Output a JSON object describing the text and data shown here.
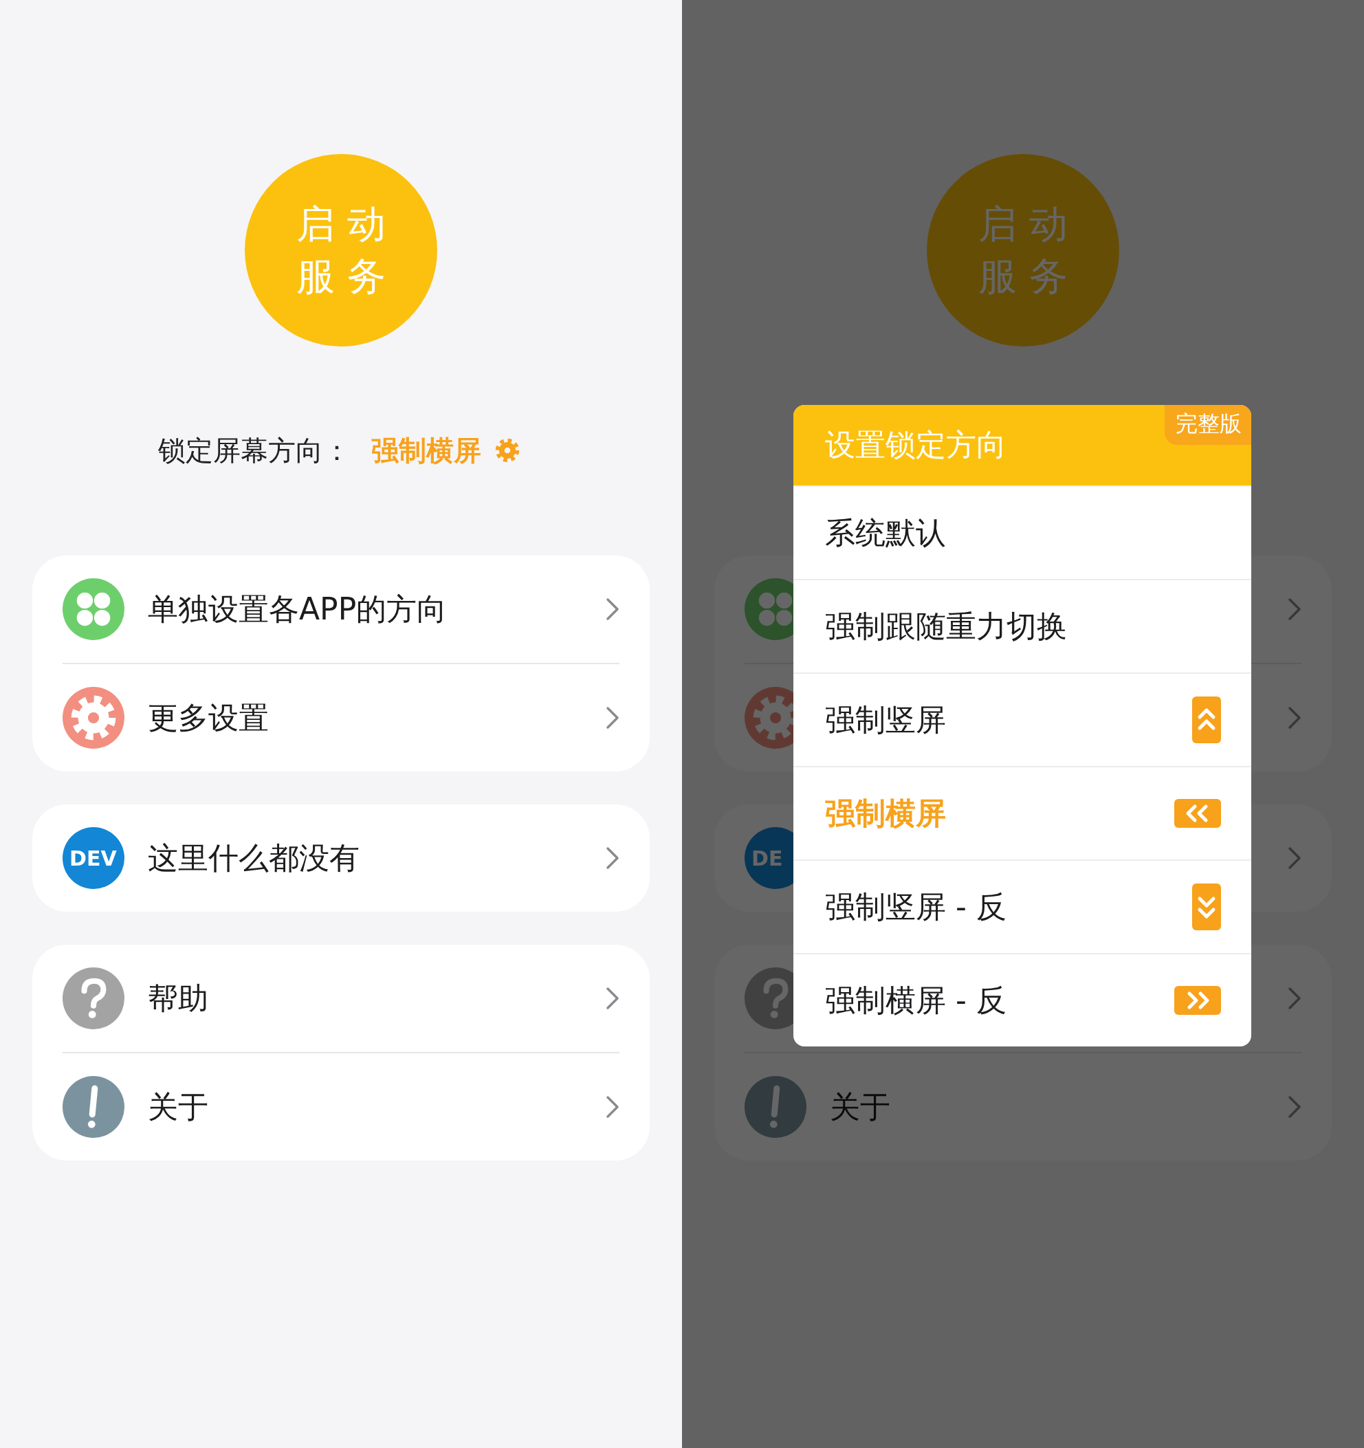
{
  "screens": [
    {
      "dimmed": false,
      "start_button": {
        "label": "启动服务"
      },
      "lock_direction": {
        "label": "锁定屏幕方向：",
        "value": "强制横屏"
      },
      "groups": [
        {
          "items": [
            {
              "kind": "apps",
              "label": "单独设置各APP的方向"
            },
            {
              "kind": "gear",
              "label": "更多设置"
            }
          ]
        },
        {
          "items": [
            {
              "kind": "dev",
              "icon_text": "DEV",
              "label": "这里什么都没有"
            }
          ]
        },
        {
          "items": [
            {
              "kind": "help",
              "label": "帮助"
            },
            {
              "kind": "info",
              "label": "关于"
            }
          ]
        }
      ]
    },
    {
      "dimmed": true,
      "start_button": {
        "label": "启动服务"
      },
      "groups": [
        {
          "items": [
            {
              "kind": "apps"
            },
            {
              "kind": "gear"
            }
          ]
        },
        {
          "items": [
            {
              "kind": "dev",
              "icon_text": "DE"
            }
          ]
        },
        {
          "items": [
            {
              "kind": "help"
            },
            {
              "kind": "info",
              "label": "关于"
            }
          ]
        }
      ]
    }
  ],
  "dialog": {
    "title": "设置锁定方向",
    "badge": "完整版",
    "options": [
      {
        "label": "系统默认",
        "selected": false
      },
      {
        "label": "强制跟随重力切换",
        "selected": false
      },
      {
        "label": "强制竖屏",
        "kind": "up",
        "selected": false
      },
      {
        "label": "强制横屏",
        "kind": "left",
        "selected": true
      },
      {
        "label": "强制竖屏 - 反",
        "kind": "down",
        "selected": false
      },
      {
        "label": "强制横屏 - 反",
        "kind": "right",
        "selected": false
      }
    ]
  }
}
